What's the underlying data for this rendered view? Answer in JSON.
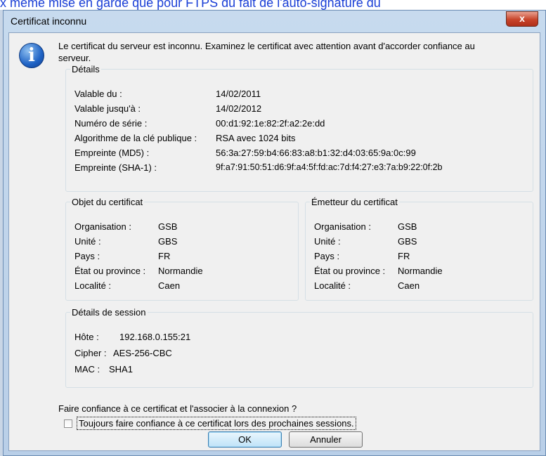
{
  "background": {
    "text": "x même mise en garde que pour FTPS du fait de l'auto-signature du"
  },
  "window": {
    "title": "Certificat inconnu",
    "close_label": "x"
  },
  "message": "Le certificat du serveur est inconnu. Examinez le certificat avec attention avant d'accorder confiance au serveur.",
  "details": {
    "legend": "Détails",
    "rows": [
      {
        "label": "Valable du :",
        "value": "14/02/2011"
      },
      {
        "label": "Valable jusqu'à :",
        "value": "14/02/2012"
      },
      {
        "label": "Numéro de série :",
        "value": "00:d1:92:1e:82:2f:a2:2e:dd"
      },
      {
        "label": "Algorithme de la clé publique :",
        "value": "RSA avec 1024 bits"
      },
      {
        "label": "Empreinte (MD5) :",
        "value": "56:3a:27:59:b4:66:83:a8:b1:32:d4:03:65:9a:0c:99"
      },
      {
        "label": "Empreinte (SHA-1) :",
        "value": "9f:a7:91:50:51:d6:9f:a4:5f:fd:ac:7d:f4:27:e3:7a:b9:22:0f:2b"
      }
    ]
  },
  "subject": {
    "legend": "Objet du certificat",
    "rows": [
      {
        "label": "Organisation :",
        "value": "GSB"
      },
      {
        "label": "Unité :",
        "value": "GBS"
      },
      {
        "label": "Pays :",
        "value": "FR"
      },
      {
        "label": "État ou province :",
        "value": "Normandie"
      },
      {
        "label": "Localité :",
        "value": "Caen"
      }
    ]
  },
  "issuer": {
    "legend": "Émetteur du certificat",
    "rows": [
      {
        "label": "Organisation :",
        "value": "GSB"
      },
      {
        "label": "Unité :",
        "value": "GBS"
      },
      {
        "label": "Pays :",
        "value": "FR"
      },
      {
        "label": "État ou province :",
        "value": "Normandie"
      },
      {
        "label": "Localité :",
        "value": "Caen"
      }
    ]
  },
  "session": {
    "legend": "Détails de session",
    "rows": [
      {
        "label": "Hôte :",
        "value": "192.168.0.155:21"
      },
      {
        "label": "Cipher :",
        "value": "AES-256-CBC"
      },
      {
        "label": "MAC :",
        "value": "SHA1"
      }
    ]
  },
  "question": "Faire confiance à ce certificat et l'associer à la connexion ?",
  "always_trust": {
    "label": "Toujours faire confiance à ce certificat lors des prochaines sessions.",
    "checked": false
  },
  "buttons": {
    "ok": "OK",
    "cancel": "Annuler"
  }
}
